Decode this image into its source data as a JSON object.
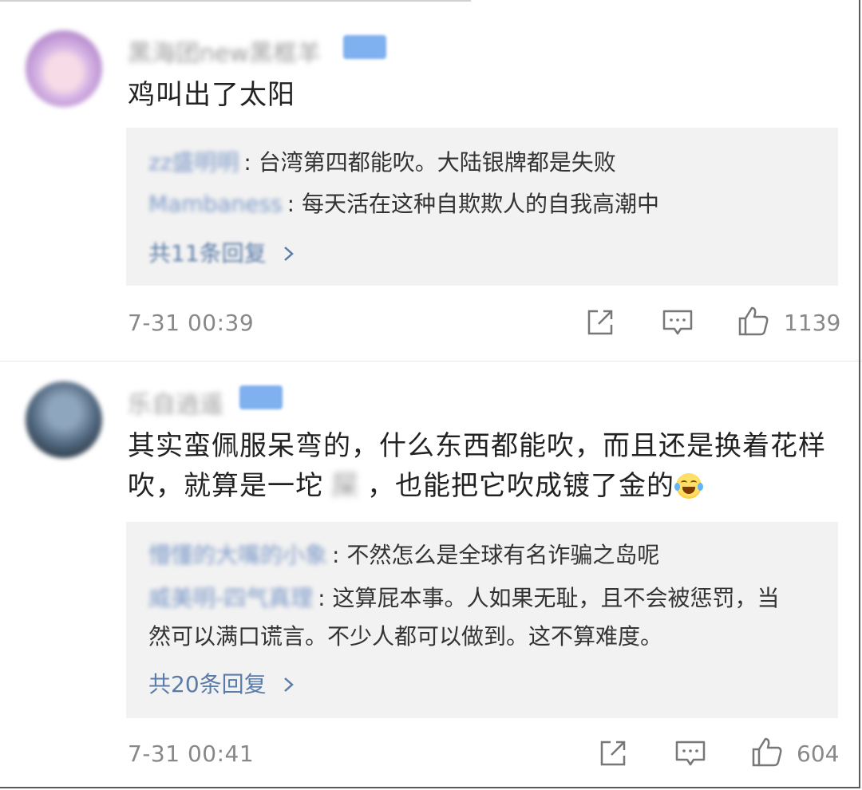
{
  "comments": [
    {
      "username": "黑海团new黑框羊",
      "content": "鸡叫出了太阳",
      "replies": [
        {
          "name": "zz盛明明",
          "text": "台湾第四都能吹。大陆银牌都是失败"
        },
        {
          "name": "Mambaness",
          "text": "每天活在这种自欺欺人的自我高潮中"
        }
      ],
      "more_replies": "共11条回复",
      "time": "7-31 00:39",
      "likes": "1139"
    },
    {
      "username": "乐自逍遥",
      "content_a": "其实蛮佩服呆弯的，什么东西都能吹，而且还是换着花样吹，就算是一坨",
      "content_blur": "屎",
      "content_b": "，也能把它吹成镀了金的",
      "replies": [
        {
          "name": "懵懂的大嘴的小象",
          "text": "不然怎么是全球有名诈骗之岛呢"
        },
        {
          "name": "威美明-四气真理",
          "text": "这算屁本事。人如果无耻，且不会被惩罚，当然可以满口谎言。不少人都可以做到。这不算难度。"
        }
      ],
      "more_replies": "共20条回复",
      "time": "7-31 00:41",
      "likes": "604"
    }
  ],
  "icons": {
    "share": "share-icon",
    "comment": "comment-icon",
    "like": "thumbs-up-icon",
    "chevron": "chevron-right-icon",
    "emoji": "laugh-cry-emoji-icon"
  },
  "colors": {
    "link": "#5b7ba8",
    "reply_bg": "#f2f2f2",
    "meta": "#888888"
  }
}
